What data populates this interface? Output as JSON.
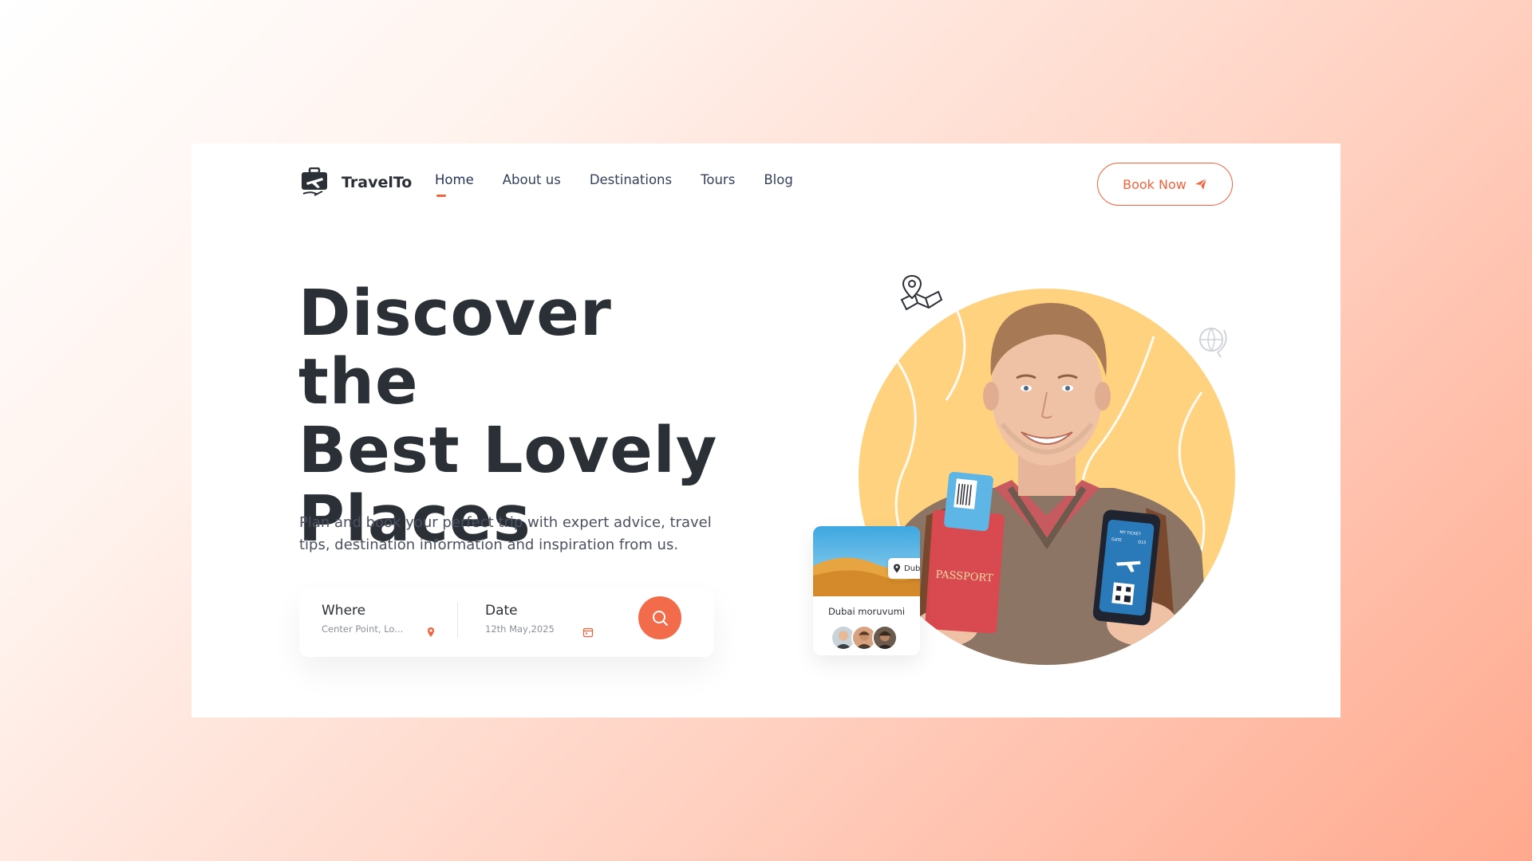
{
  "brand": {
    "name": "TravelTo"
  },
  "nav": {
    "items": [
      {
        "label": "Home",
        "active": true
      },
      {
        "label": "About us",
        "active": false
      },
      {
        "label": "Destinations",
        "active": false
      },
      {
        "label": "Tours",
        "active": false
      },
      {
        "label": "Blog",
        "active": false
      }
    ],
    "cta_label": "Book Now"
  },
  "hero": {
    "headline_lines": [
      "Discover the",
      "Best Lovely",
      "Places"
    ],
    "subtext": "Plan and book your perfect trip with expert advice, travel tips, destination information and inspiration from us."
  },
  "search": {
    "where_label": "Where",
    "where_value": "Center Point, Lo...",
    "date_label": "Date",
    "date_value": "12th May,2025"
  },
  "destination_card": {
    "tag": "Dubai",
    "name": "Dubai moruvumi"
  },
  "phone_text": {
    "title": "MY TICKET",
    "gate_label": "GATE",
    "gate_value": "D15"
  },
  "passport_text": "PASSPORT",
  "colors": {
    "accent": "#f4623a",
    "circle": "#ffd27f",
    "text_dark": "#2b2f36"
  }
}
